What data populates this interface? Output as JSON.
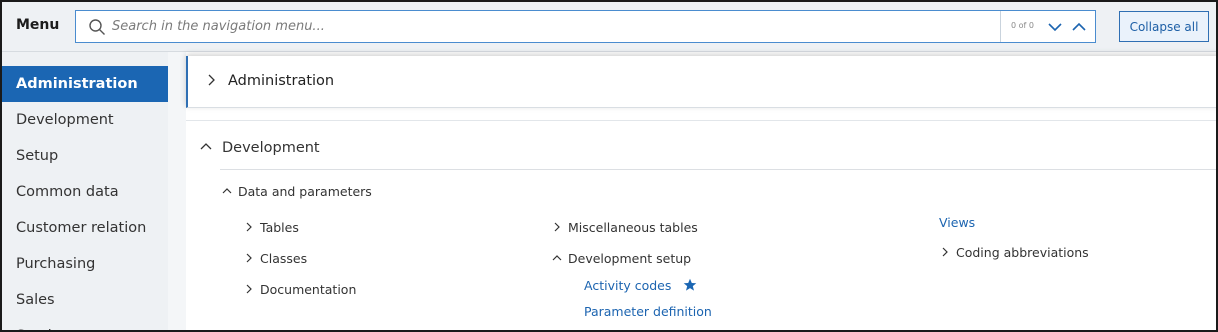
{
  "header": {
    "menu_title": "Menu",
    "search_placeholder": "Search in the navigation menu...",
    "match_count": "0 of 0",
    "collapse_label": "Collapse all"
  },
  "sidebar": {
    "items": [
      {
        "label": "Administration",
        "active": true
      },
      {
        "label": "Development"
      },
      {
        "label": "Setup"
      },
      {
        "label": "Common data"
      },
      {
        "label": "Customer relation"
      },
      {
        "label": "Purchasing"
      },
      {
        "label": "Sales"
      },
      {
        "label": "Stock"
      }
    ]
  },
  "content": {
    "administration": {
      "title": "Administration",
      "expanded": false
    },
    "development": {
      "title": "Development",
      "expanded": true,
      "group": {
        "title": "Data and parameters",
        "col1": [
          "Tables",
          "Classes",
          "Documentation"
        ],
        "col2": {
          "misc": "Miscellaneous tables",
          "dev_setup": "Development setup",
          "activity_codes": "Activity codes",
          "parameter_definition": "Parameter definition"
        },
        "col3": {
          "views": "Views",
          "coding_abbreviations": "Coding abbreviations"
        }
      }
    }
  },
  "colors": {
    "accent": "#1b66b3",
    "link": "#1c64b0",
    "sidebar_bg": "#eef1f4"
  },
  "icons": {
    "search": "search-icon",
    "down": "chevron-down-icon",
    "up": "chevron-up-icon",
    "right": "chevron-right-icon",
    "star": "star-icon"
  }
}
